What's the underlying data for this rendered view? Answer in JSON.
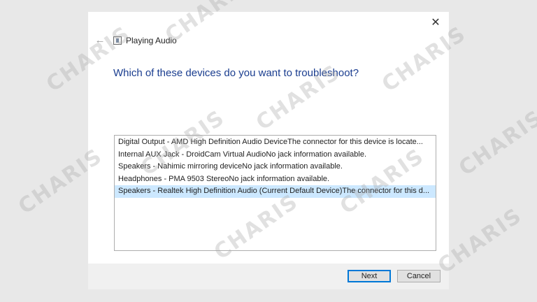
{
  "window": {
    "title": "Playing Audio",
    "close_glyph": "✕",
    "back_glyph": "←"
  },
  "heading": "Which of these devices do you want to troubleshoot?",
  "devices": [
    {
      "label": "Digital Output - AMD High Definition Audio DeviceThe connector for this device is locate...",
      "selected": false
    },
    {
      "label": "Internal AUX Jack - DroidCam Virtual AudioNo jack information available.",
      "selected": false
    },
    {
      "label": "Speakers - Nahimic mirroring deviceNo jack information available.",
      "selected": false
    },
    {
      "label": "Headphones - PMA 9503 StereoNo jack information available.",
      "selected": false
    },
    {
      "label": "Speakers - Realtek High Definition Audio (Current Default Device)The connector for this d...",
      "selected": true
    }
  ],
  "buttons": {
    "next": "Next",
    "cancel": "Cancel"
  },
  "watermark": "CHARIS",
  "colors": {
    "heading": "#1a3d8f",
    "selection": "#cce8ff",
    "default_button_border": "#0078d7"
  }
}
